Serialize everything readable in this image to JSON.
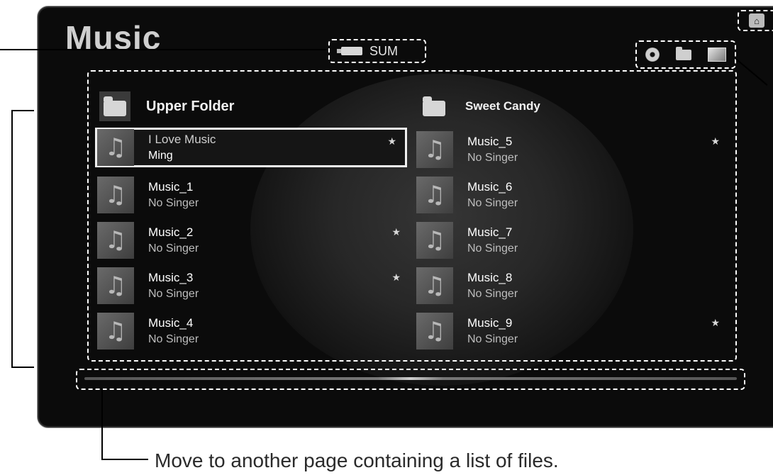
{
  "app": {
    "title": "Music",
    "device": "SUM"
  },
  "view_icons": [
    "disc-icon",
    "folder-icon",
    "photo-icon"
  ],
  "home_icon": "home-icon",
  "folders": [
    {
      "label": "Upper Folder",
      "icon": "folder-back-icon"
    },
    {
      "label": "Sweet Candy",
      "icon": "folder-icon"
    }
  ],
  "tracks_left": [
    {
      "title": "I Love Music",
      "artist": "Ming",
      "favorite": true,
      "selected": true
    },
    {
      "title": "Music_1",
      "artist": "No Singer",
      "favorite": false
    },
    {
      "title": "Music_2",
      "artist": "No Singer",
      "favorite": true
    },
    {
      "title": "Music_3",
      "artist": "No Singer",
      "favorite": true
    },
    {
      "title": "Music_4",
      "artist": "No Singer",
      "favorite": false
    }
  ],
  "tracks_right": [
    {
      "title": "Music_5",
      "artist": "No Singer",
      "favorite": true
    },
    {
      "title": "Music_6",
      "artist": "No Singer",
      "favorite": false
    },
    {
      "title": "Music_7",
      "artist": "No Singer",
      "favorite": false
    },
    {
      "title": "Music_8",
      "artist": "No Singer",
      "favorite": false
    },
    {
      "title": "Music_9",
      "artist": "No Singer",
      "favorite": true
    }
  ],
  "caption": "Move to another page containing a list of files.",
  "colors": {
    "panel_bg": "#0b0b0b",
    "highlight_border": "#f0f0f0",
    "annotation_dash": "#ffffff"
  }
}
